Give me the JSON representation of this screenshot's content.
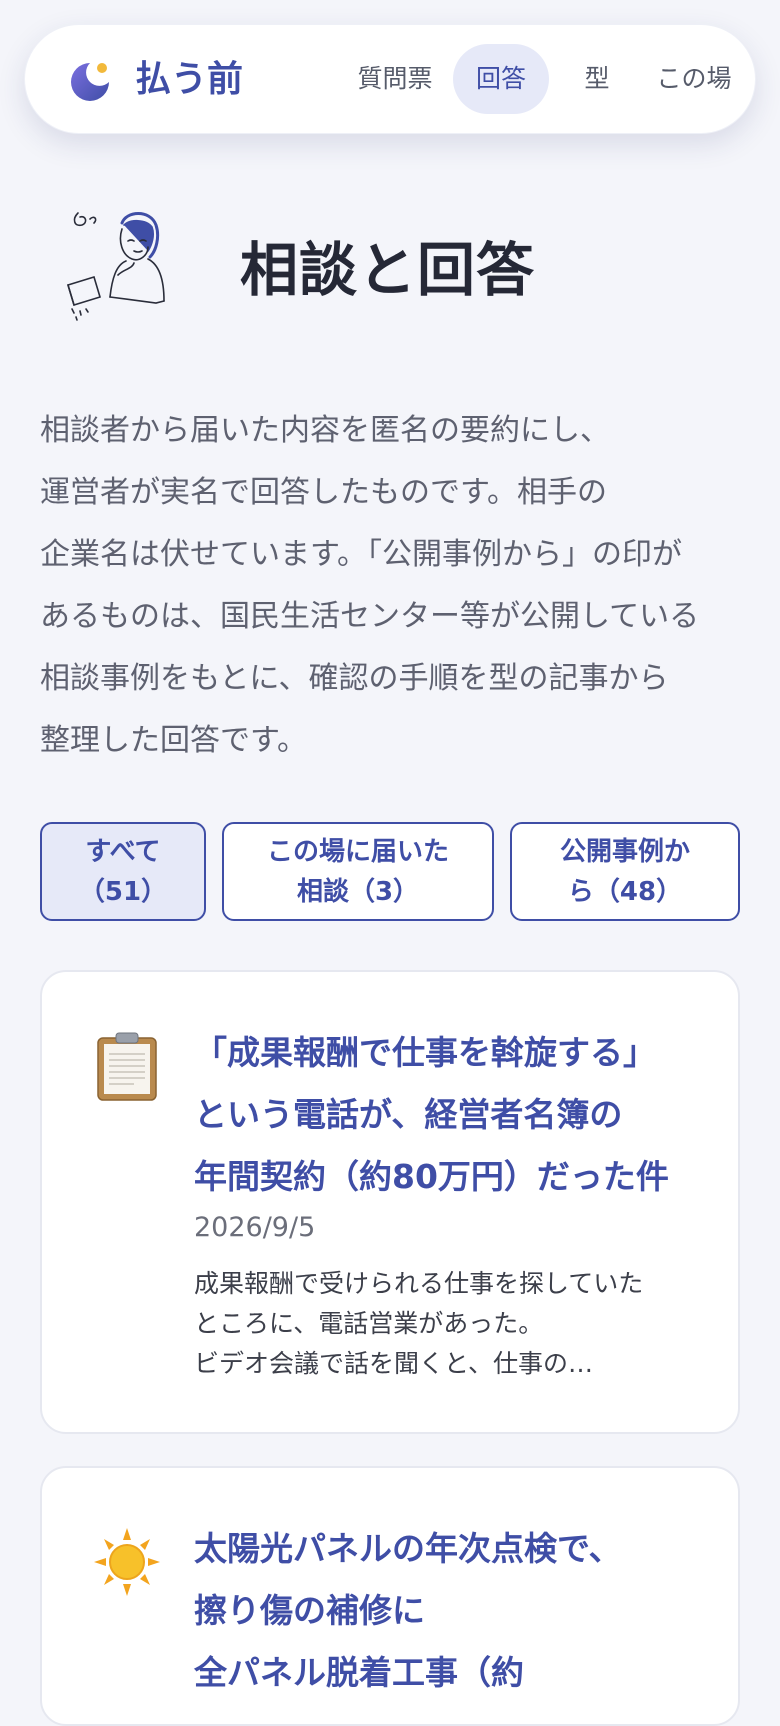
{
  "header": {
    "brand": "払う前",
    "logo_icon": "crescent-logo-icon",
    "nav": [
      {
        "label": "質問票",
        "active": false
      },
      {
        "label": "回答",
        "active": true
      },
      {
        "label": "型",
        "active": false
      },
      {
        "label": "この場",
        "active": false
      }
    ]
  },
  "hero": {
    "illustration": "worried-person-illustration",
    "title": "相談と回答"
  },
  "intro": {
    "lines": [
      "相談者から届いた内容を匿名の要約にし、",
      "運営者が実名で回答したものです。相手の",
      "企業名は伏せています。「公開事例から」の印が",
      "あるものは、国民生活センター等が公開している",
      "相談事例をもとに、確認の手順を型の記事から",
      "整理した回答です。"
    ]
  },
  "filters": [
    {
      "lines": [
        "すべて",
        "（51）"
      ],
      "active": true
    },
    {
      "lines": [
        "この場に届いた",
        "相談（3）"
      ],
      "active": false
    },
    {
      "lines": [
        "公開事例か",
        "ら（48）"
      ],
      "active": false
    }
  ],
  "cards": [
    {
      "icon": "clipboard-icon",
      "title_lines": [
        "「成果報酬で仕事を斡旋する」",
        "という電話が、経営者名簿の",
        "年間契約（約80万円）だった件"
      ],
      "date": "2026/9/5",
      "excerpt_lines": [
        "成果報酬で受けられる仕事を探していた",
        "ところに、電話営業があった。",
        "ビデオ会議で話を聞くと、仕事の…"
      ]
    },
    {
      "icon": "sun-icon",
      "title_lines": [
        "太陽光パネルの年次点検で、",
        "擦り傷の補修に",
        "全パネル脱着工事（約"
      ]
    }
  ],
  "colors": {
    "accent": "#3f4ea6",
    "accent_soft": "#e6e9f8",
    "background": "#f4f5fa",
    "heading": "#252836",
    "body_text": "#5e6170"
  }
}
